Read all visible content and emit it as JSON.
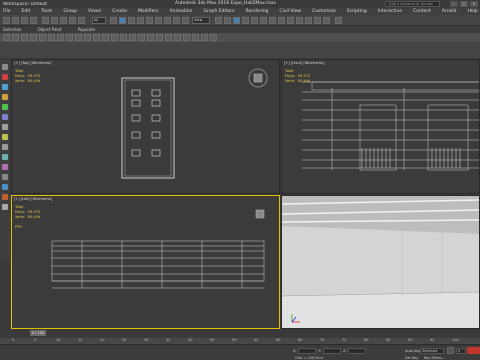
{
  "app": {
    "window_title": "Autodesk 3ds Max 2018    Expo_Hall2Max.max",
    "workspace": "Workspace: Default",
    "search_placeholder": "Type a keyword or phrase",
    "menu": [
      "File",
      "Edit",
      "Tools",
      "Group",
      "Views",
      "Create",
      "Modifiers",
      "Animation",
      "Graph Editors",
      "Rendering",
      "Civil View",
      "Customize",
      "Scripting",
      "Interactive",
      "Content",
      "Arnold",
      "Help"
    ],
    "selection_filter": "All",
    "view_dropdown": "View",
    "ribbon": [
      "Selection",
      "Object Paint",
      "Populate"
    ]
  },
  "viewports": {
    "top": {
      "label": "[+] [Top] [Wireframe]",
      "stats": "Total\nPolys:  93,972\nVerts:  85,444"
    },
    "front": {
      "label": "[+] [Front] [Wireframe]",
      "stats": "Total\nPolys:  93,972\nVerts:  85,444"
    },
    "left": {
      "label": "[+] [Left] [Wireframe]",
      "stats": "Total\nPolys:  93,972\nVerts:  85,444\n\nFPS:"
    },
    "perspective": {
      "label": ""
    }
  },
  "timeline": {
    "slider": "0 / 100",
    "ticks": [
      "0",
      "5",
      "10",
      "15",
      "20",
      "25",
      "30",
      "35",
      "40",
      "45",
      "50",
      "55",
      "60",
      "65",
      "70",
      "75",
      "80",
      "85",
      "90",
      "95",
      "100"
    ]
  },
  "status": {
    "x_label": "X:",
    "y_label": "Y:",
    "z_label": "Z:",
    "grid": "Grid = 100,0cm",
    "auto_key": "Auto Key",
    "selected": "Selected",
    "set_key": "Set Key",
    "key_filters": "Key Filters...",
    "frame": "0"
  },
  "colors": {
    "active_border": "#e0c000",
    "stats_text": "#e8c84a",
    "set_key": "#c0362c"
  }
}
